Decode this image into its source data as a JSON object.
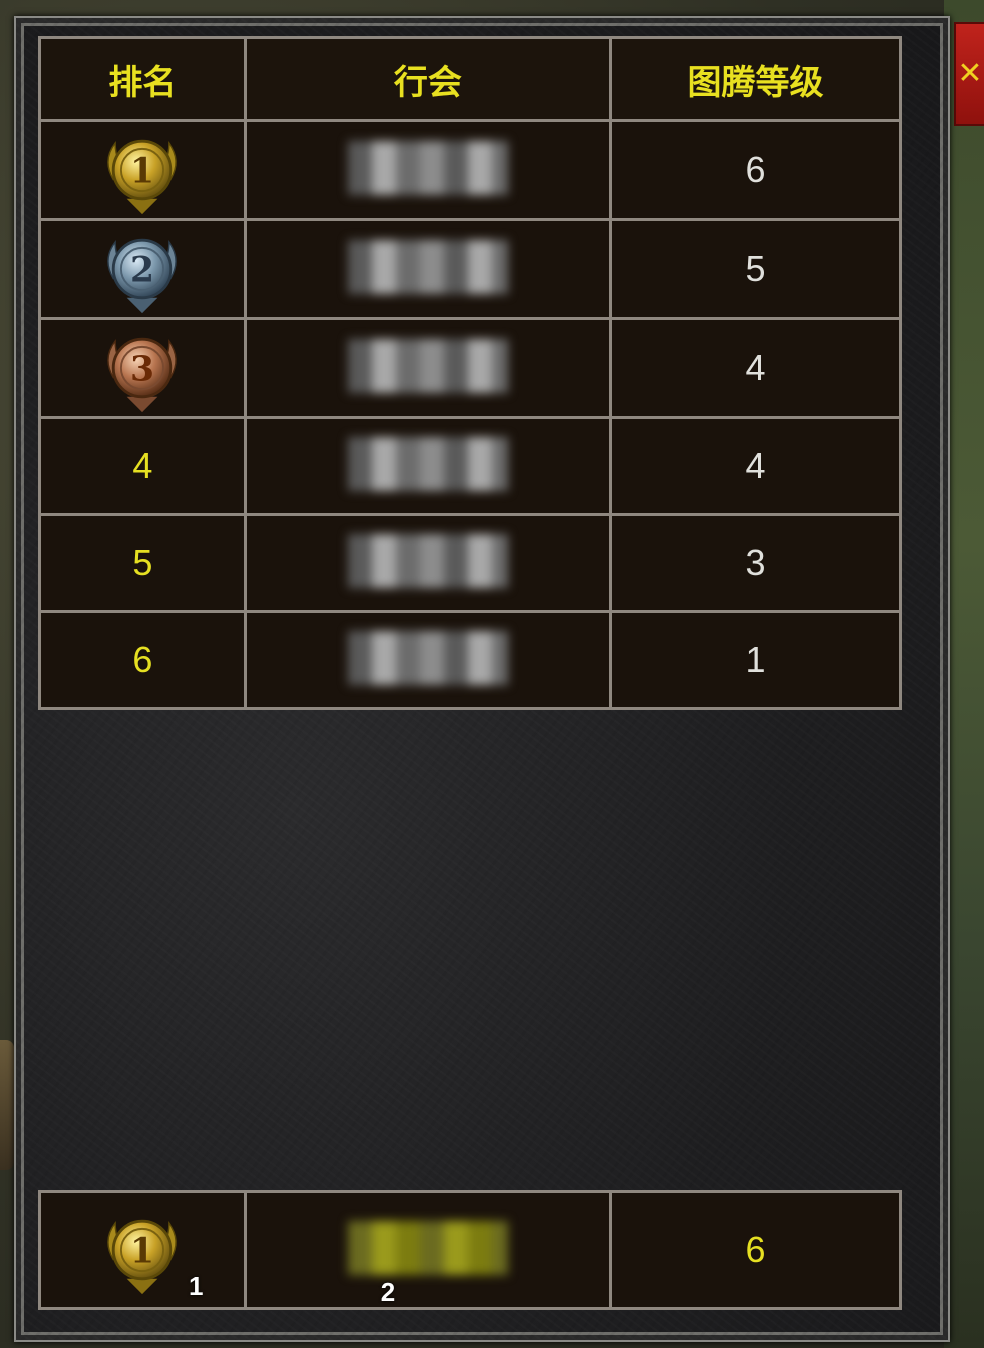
{
  "header": {
    "rank": "排名",
    "guild": "行会",
    "totem_level": "图腾等级"
  },
  "rows": [
    {
      "rank": "1",
      "guild": "",
      "level": "6",
      "medal": "gold"
    },
    {
      "rank": "2",
      "guild": "",
      "level": "5",
      "medal": "silver"
    },
    {
      "rank": "3",
      "guild": "",
      "level": "4",
      "medal": "bronze"
    },
    {
      "rank": "4",
      "guild": "",
      "level": "4",
      "medal": ""
    },
    {
      "rank": "5",
      "guild": "",
      "level": "3",
      "medal": ""
    },
    {
      "rank": "6",
      "guild": "",
      "level": "1",
      "medal": ""
    }
  ],
  "my_guild": {
    "rank": "1",
    "level": "6",
    "badge_rank": "1",
    "badge_guild": "2",
    "medal": "gold"
  },
  "close_button": {
    "label": "✕",
    "icon": "close-icon"
  },
  "colors": {
    "header_text": "#e8e020",
    "rank_text": "#e6e022",
    "level_text": "#e0e0dc",
    "grid_line": "#8f8880",
    "close_button_bg": "#c0231c"
  }
}
